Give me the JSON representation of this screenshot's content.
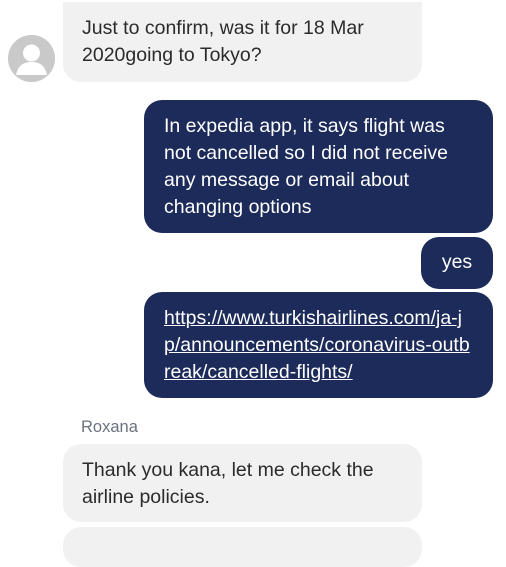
{
  "messages": [
    {
      "direction": "incoming",
      "text": "Just to confirm, was it for 18 Mar 2020going to Tokyo?"
    },
    {
      "direction": "outgoing",
      "text": "In expedia app, it says flight was not cancelled so I did not receive any message or email about changing options"
    },
    {
      "direction": "outgoing",
      "text": "yes"
    },
    {
      "direction": "outgoing",
      "text": "https://www.turkishairlines.com/ja-jp/announcements/coronavirus-outbreak/cancelled-flights/"
    },
    {
      "direction": "incoming",
      "sender": "Roxana",
      "text": "Thank you kana, let me check the airline policies."
    }
  ],
  "icons": {
    "avatar": "default-user-avatar-icon"
  },
  "colors": {
    "outgoing_bubble": "#1c2b5a",
    "incoming_bubble": "#f1f1f1",
    "sender_name": "#6b7280"
  }
}
